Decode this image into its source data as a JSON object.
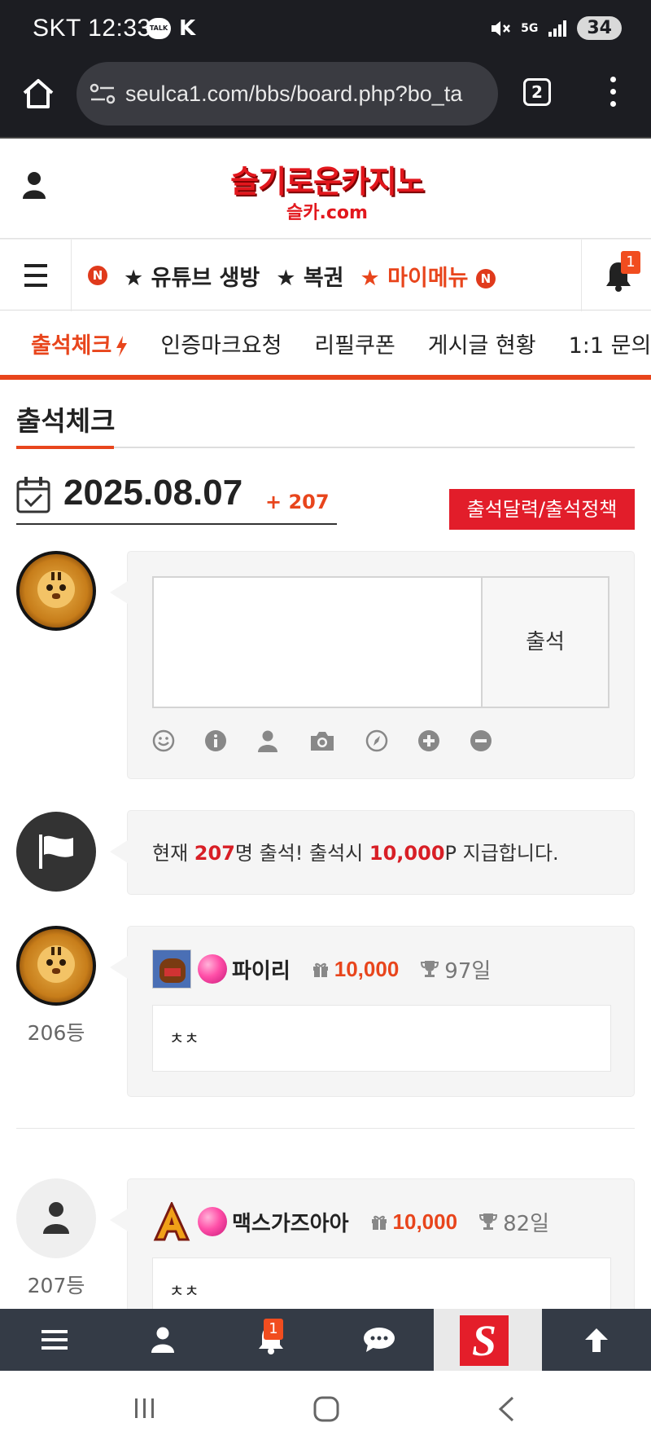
{
  "status_bar": {
    "carrier_time": "SKT 12:33",
    "talk_label": "TALK",
    "k_icon": "K",
    "network": "5G",
    "battery": "34"
  },
  "browser": {
    "url": "seulca1.com/bbs/board.php?bo_ta",
    "tab_count": "2"
  },
  "header": {
    "logo_main": "슬기로운카지노",
    "logo_sub": "슬카.com"
  },
  "main_nav": {
    "items": [
      {
        "label": "N",
        "type": "badge"
      },
      {
        "label": "★ 유튜브 생방"
      },
      {
        "label": "★ 복권"
      },
      {
        "label": "★ 마이메뉴"
      }
    ],
    "new_badge": "N",
    "bell_count": "1"
  },
  "sub_nav": {
    "items": [
      "출석체크",
      "인증마크요청",
      "리필쿠폰",
      "게시글 현황",
      "1:1 문의"
    ]
  },
  "page": {
    "title": "출석체크",
    "date": "2025.08.07",
    "count_label": "+ 207",
    "calendar_button": "출석달력/출석정책",
    "submit_label": "출석",
    "info": {
      "prefix": "현재 ",
      "count": "207",
      "middle": "명 출석! 출석시 ",
      "points": "10,000",
      "suffix": "P 지급합니다."
    }
  },
  "entries": [
    {
      "rank": "206등",
      "nick": "파이리",
      "points": "10,000",
      "days": "97일",
      "comment": "ㅊㅊ"
    },
    {
      "rank": "207등",
      "nick": "맥스가즈아아",
      "points": "10,000",
      "days": "82일",
      "comment": "ㅊㅊ"
    }
  ],
  "bottom_bar": {
    "bell_count": "1",
    "logo": "S"
  },
  "colors": {
    "accent": "#e8451c",
    "red_button": "#e21d2a",
    "dark_bar": "#1c1d22",
    "bottom_bar": "#343b46"
  }
}
